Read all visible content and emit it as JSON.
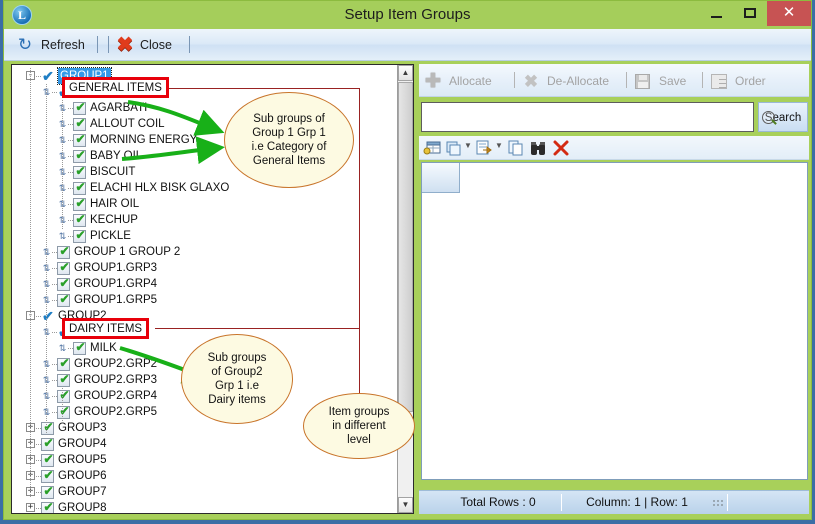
{
  "window": {
    "title": "Setup Item Groups",
    "app_icon": "L",
    "minimize": "minimize-icon",
    "maximize": "maximize-icon",
    "close": "close-icon"
  },
  "toolbar": {
    "refresh_label": "Refresh",
    "close_label": "Close"
  },
  "tree": {
    "nodes": [
      {
        "label": "GROUP1",
        "depth": 0,
        "expander": "-",
        "check": "blue-check",
        "selected": true
      },
      {
        "label": "GENERAL ITEMS",
        "depth": 1,
        "expander": "",
        "check": "blue-check",
        "selected": false,
        "boxed": true
      },
      {
        "label": "AGARBATI",
        "depth": 2,
        "expander": "",
        "check": "green-check",
        "selected": false
      },
      {
        "label": "ALLOUT COIL",
        "depth": 2,
        "expander": "",
        "check": "green-check",
        "selected": false
      },
      {
        "label": "MORNING ENERGY",
        "depth": 2,
        "expander": "",
        "check": "green-check",
        "selected": false
      },
      {
        "label": "BABY OIL",
        "depth": 2,
        "expander": "",
        "check": "green-check",
        "selected": false
      },
      {
        "label": "BISCUIT",
        "depth": 2,
        "expander": "",
        "check": "green-check",
        "selected": false
      },
      {
        "label": "ELACHI HLX BISK GLAXO",
        "depth": 2,
        "expander": "",
        "check": "green-check",
        "selected": false
      },
      {
        "label": "HAIR OIL",
        "depth": 2,
        "expander": "",
        "check": "green-check",
        "selected": false
      },
      {
        "label": "KECHUP",
        "depth": 2,
        "expander": "",
        "check": "green-check",
        "selected": false
      },
      {
        "label": "PICKLE",
        "depth": 2,
        "expander": "",
        "check": "green-check",
        "selected": false
      },
      {
        "label": "GROUP 1 GROUP 2",
        "depth": 1,
        "expander": "",
        "check": "green-check",
        "selected": false
      },
      {
        "label": "GROUP1.GRP3",
        "depth": 1,
        "expander": "",
        "check": "green-check",
        "selected": false
      },
      {
        "label": "GROUP1.GRP4",
        "depth": 1,
        "expander": "",
        "check": "green-check",
        "selected": false
      },
      {
        "label": "GROUP1.GRP5",
        "depth": 1,
        "expander": "",
        "check": "green-check",
        "selected": false
      },
      {
        "label": "GROUP2",
        "depth": 0,
        "expander": "-",
        "check": "blue-check",
        "selected": false
      },
      {
        "label": "DAIRY ITEMS",
        "depth": 1,
        "expander": "",
        "check": "blue-check",
        "selected": false,
        "boxed": true
      },
      {
        "label": "MILK",
        "depth": 2,
        "expander": "",
        "check": "green-check",
        "selected": false
      },
      {
        "label": "GROUP2.GRP2",
        "depth": 1,
        "expander": "",
        "check": "green-check",
        "selected": false
      },
      {
        "label": "GROUP2.GRP3",
        "depth": 1,
        "expander": "",
        "check": "green-check",
        "selected": false
      },
      {
        "label": "GROUP2.GRP4",
        "depth": 1,
        "expander": "",
        "check": "green-check",
        "selected": false
      },
      {
        "label": "GROUP2.GRP5",
        "depth": 1,
        "expander": "",
        "check": "green-check",
        "selected": false
      },
      {
        "label": "GROUP3",
        "depth": 0,
        "expander": "+",
        "check": "green-check",
        "selected": false
      },
      {
        "label": "GROUP4",
        "depth": 0,
        "expander": "+",
        "check": "green-check",
        "selected": false
      },
      {
        "label": "GROUP5",
        "depth": 0,
        "expander": "+",
        "check": "green-check",
        "selected": false
      },
      {
        "label": "GROUP6",
        "depth": 0,
        "expander": "+",
        "check": "green-check",
        "selected": false
      },
      {
        "label": "GROUP7",
        "depth": 0,
        "expander": "+",
        "check": "green-check",
        "selected": false
      },
      {
        "label": "GROUP8",
        "depth": 0,
        "expander": "+",
        "check": "green-check",
        "selected": false
      }
    ]
  },
  "right_panel": {
    "actions": [
      {
        "label": "Allocate",
        "icon": "plus-icon",
        "disabled": true
      },
      {
        "label": "De-Allocate",
        "icon": "x-icon",
        "disabled": true
      },
      {
        "label": "Save",
        "icon": "floppy-icon",
        "disabled": true
      },
      {
        "label": "Order",
        "icon": "checklist-icon",
        "disabled": true
      }
    ],
    "search": {
      "value": "",
      "placeholder": "",
      "button_label": "Search"
    },
    "grid_tools": [
      {
        "icon": "table-key-icon"
      },
      {
        "icon": "copy-icon",
        "dropdown": true
      },
      {
        "icon": "export-icon",
        "dropdown": true
      },
      {
        "icon": "duplicate-icon"
      },
      {
        "icon": "find-binoculars-icon"
      },
      {
        "icon": "delete-x-icon"
      }
    ],
    "status": {
      "total_rows": "Total Rows : 0",
      "position": "Column: 1 | Row: 1"
    }
  },
  "annotations": {
    "boxes": [
      {
        "id": "general-items",
        "text": "GENERAL ITEMS"
      },
      {
        "id": "dairy-items",
        "text": "DAIRY ITEMS"
      }
    ],
    "bubbles": [
      {
        "id": "bubble-group1",
        "lines": [
          "Sub groups of",
          "Group 1 Grp 1",
          "i.e Category of",
          "General Items"
        ]
      },
      {
        "id": "bubble-group2",
        "lines": [
          "Sub groups",
          "of Group2",
          "Grp 1 i.e",
          "Dairy items"
        ]
      },
      {
        "id": "bubble-levels",
        "lines": [
          "Item groups",
          "in different",
          "level"
        ]
      }
    ]
  },
  "colors": {
    "title_bar": "#a5ce5b",
    "close_button": "#c75353",
    "selection": "#3399e6",
    "annotation_red": "#e8000a",
    "annotation_line": "#992222",
    "bubble_border": "#c8742a",
    "bubble_fill": "#fdfae2",
    "arrow_green": "#1faa1f",
    "desktop": "#3b6ea5"
  }
}
